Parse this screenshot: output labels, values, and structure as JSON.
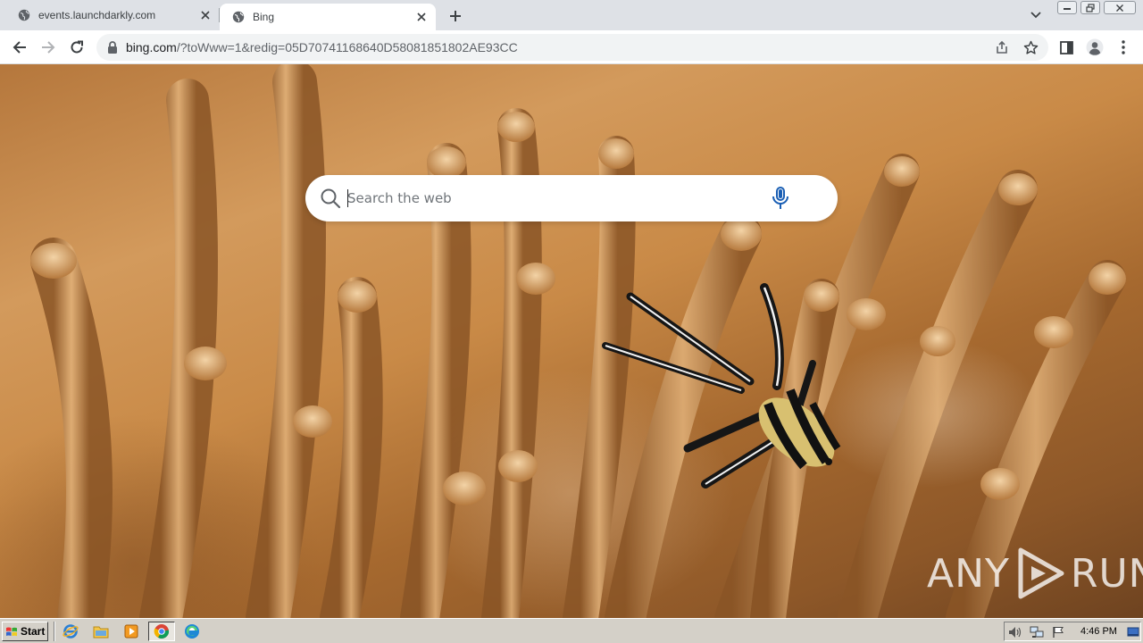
{
  "browser": {
    "tabs": [
      {
        "title": "events.launchdarkly.com",
        "active": false
      },
      {
        "title": "Bing",
        "active": true
      }
    ],
    "address": {
      "host": "bing.com",
      "path": "/?toWww=1&redig=05D70741168640D58081851802AE93CC"
    }
  },
  "page": {
    "search": {
      "placeholder": "Search the web",
      "value": ""
    },
    "watermark": {
      "left": "ANY",
      "right": "RUN"
    }
  },
  "taskbar": {
    "start_label": "Start",
    "clock": "4:46 PM"
  },
  "colors": {
    "tabstrip": "#dee1e6",
    "toolbar": "#ffffff",
    "omnibox": "#f1f3f4",
    "taskbar": "#d4d0c8",
    "mic_accent": "#1a5fb4"
  }
}
